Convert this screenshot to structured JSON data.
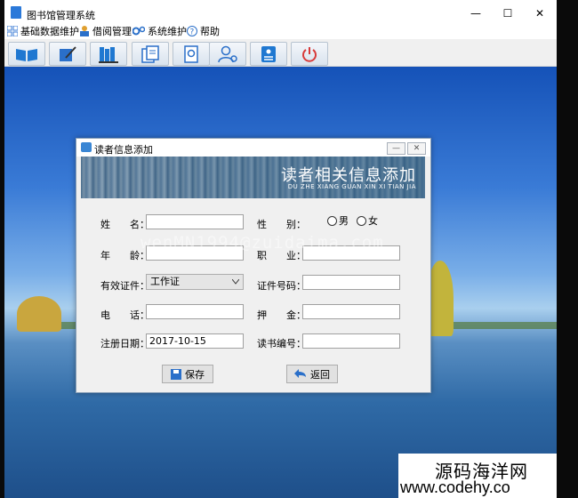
{
  "window": {
    "title": "图书馆管理系统",
    "minimize_glyph": "—",
    "maximize_glyph": "☐",
    "close_glyph": "✕"
  },
  "menu": [
    {
      "label": "基础数据维护",
      "icon": "grid-icon"
    },
    {
      "label": "借阅管理",
      "icon": "book-user-icon"
    },
    {
      "label": "系统维护",
      "icon": "gears-icon"
    },
    {
      "label": "帮助",
      "icon": "help-icon"
    }
  ],
  "toolbar": [
    {
      "icon": "open-book-icon"
    },
    {
      "icon": "notebook-pen-icon"
    },
    {
      "icon": "bookshelf-icon"
    },
    {
      "icon": "documents-icon"
    },
    {
      "icon": "search-book-icon"
    },
    {
      "icon": "user-settings-icon"
    },
    {
      "icon": "id-card-icon"
    },
    {
      "icon": "power-icon"
    }
  ],
  "dialog": {
    "title": "读者信息添加",
    "banner_title": "读者相关信息添加",
    "banner_pinyin": "DU ZHE XIANG GUAN XIN XI TIAN JIA",
    "labels": {
      "name": "姓　　名：",
      "gender": "性　　别：",
      "age": "年　　龄：",
      "job": "职　　业：",
      "id_type": "有效证件：",
      "id_number": "证件号码：",
      "phone": "电　　话：",
      "deposit": "押　　金：",
      "reg_date": "注册日期：",
      "reader_no": "读书编号："
    },
    "gender_options": [
      "男",
      "女"
    ],
    "values": {
      "name": "",
      "age": "",
      "job": "",
      "id_type": "工作证",
      "id_number": "",
      "phone": "",
      "deposit": "",
      "reg_date": "2017-10-15",
      "reader_no": ""
    },
    "save_label": "保存",
    "back_label": "返回"
  },
  "watermark": "wenMN1994@zuidaima.com",
  "site_badge": {
    "name": "源码海洋网",
    "url": "www.codehy.co"
  }
}
